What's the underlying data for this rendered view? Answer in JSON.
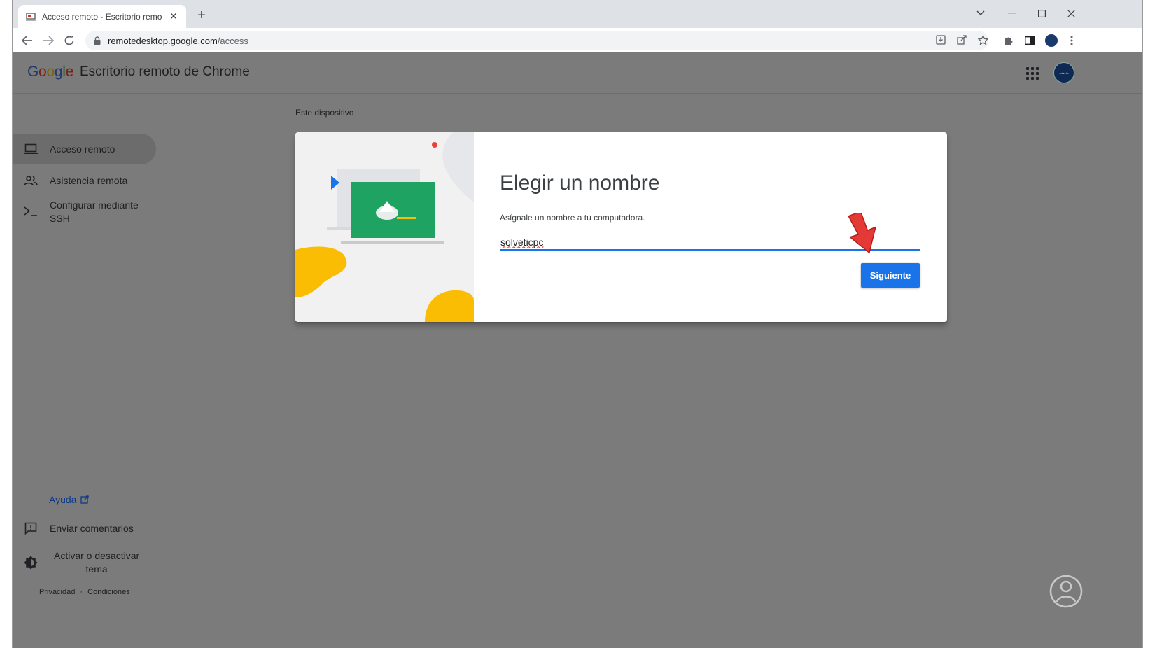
{
  "browser": {
    "tab_title": "Acceso remoto - Escritorio remo",
    "url_host": "remotedesktop.google.com",
    "url_path": "/access"
  },
  "header": {
    "logo": "Google",
    "title": "Escritorio remoto de Chrome"
  },
  "sidebar": {
    "items": [
      {
        "label": "Acceso remoto",
        "icon": "laptop-icon"
      },
      {
        "label": "Asistencia remota",
        "icon": "people-icon"
      },
      {
        "label_line1": "Configurar mediante",
        "label_line2": "SSH",
        "icon": "terminal-icon"
      }
    ],
    "help": "Ayuda",
    "feedback": "Enviar comentarios",
    "theme_line1": "Activar o desactivar",
    "theme_line2": "tema",
    "privacy": "Privacidad",
    "separator": "·",
    "terms": "Condiciones"
  },
  "main": {
    "section_title": "Este dispositivo",
    "dialog": {
      "title": "Elegir un nombre",
      "subtitle": "Asígnale un nombre a tu computadora.",
      "input_value": "solveticpc",
      "next_label": "Siguiente"
    }
  },
  "colors": {
    "accent": "#1a73e8",
    "overlay": "#7b7b7b",
    "arrow": "#e53935"
  }
}
